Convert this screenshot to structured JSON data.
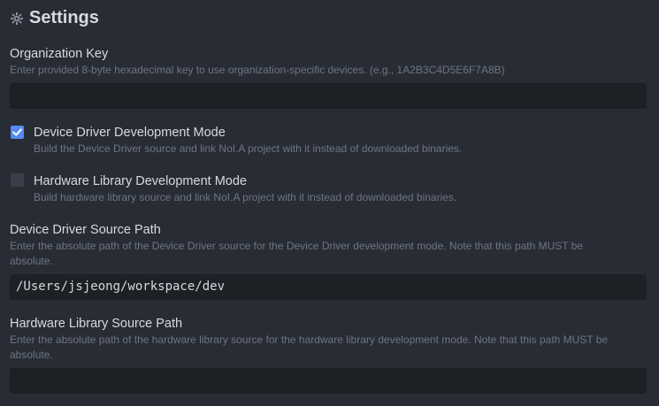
{
  "header": {
    "icon": "gear-icon",
    "title": "Settings"
  },
  "org_key": {
    "label": "Organization Key",
    "description": "Enter provided 8-byte hexadecimal key to use organization-specific devices. (e.g., 1A2B3C4D5E6F7A8B)",
    "value": ""
  },
  "driver_dev_mode": {
    "checked": true,
    "label": "Device Driver Development Mode",
    "description": "Build the Device Driver source and link NoI.A project with it instead of downloaded binaries."
  },
  "hwlib_dev_mode": {
    "checked": false,
    "label": "Hardware Library Development Mode",
    "description": "Build hardware library source and link NoI.A project with it instead of downloaded binaries."
  },
  "driver_source_path": {
    "label": "Device Driver Source Path",
    "description": "Enter the absolute path of the Device Driver source for the Device Driver development mode. Note that this path MUST be absolute.",
    "value": "/Users/jsjeong/workspace/dev"
  },
  "hwlib_source_path": {
    "label": "Hardware Library Source Path",
    "description": "Enter the absolute path of the hardware library source for the hardware library development mode. Note that this path MUST be absolute.",
    "value": ""
  },
  "colors": {
    "background": "#282c34",
    "input_background": "#1d2025",
    "accent": "#568af2"
  }
}
